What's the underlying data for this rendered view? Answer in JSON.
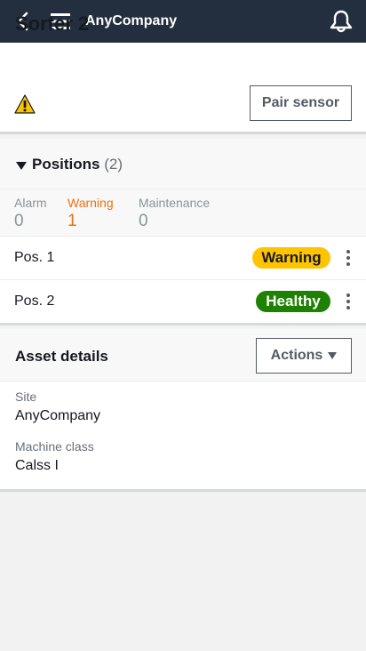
{
  "topbar": {
    "title": "AnyCompany"
  },
  "header": {
    "title": "Sorter 2",
    "pair_label": "Pair sensor"
  },
  "positions": {
    "label": "Positions",
    "count_text": "(2)",
    "summary": [
      {
        "label": "Alarm",
        "value": "0"
      },
      {
        "label": "Warning",
        "value": "1"
      },
      {
        "label": "Maintenance",
        "value": "0"
      }
    ],
    "items": [
      {
        "name": "Pos. 1",
        "status": "Warning"
      },
      {
        "name": "Pos. 2",
        "status": "Healthy"
      }
    ]
  },
  "asset": {
    "title": "Asset details",
    "actions_label": "Actions",
    "fields": [
      {
        "label": "Site",
        "value": "AnyCompany"
      },
      {
        "label": "Machine class",
        "value": "Calss I"
      }
    ]
  },
  "colors": {
    "topbar": "#232f3e",
    "warning_badge": "#ffc400",
    "healthy_badge": "#1d8102",
    "warning_text": "#ec7211"
  }
}
